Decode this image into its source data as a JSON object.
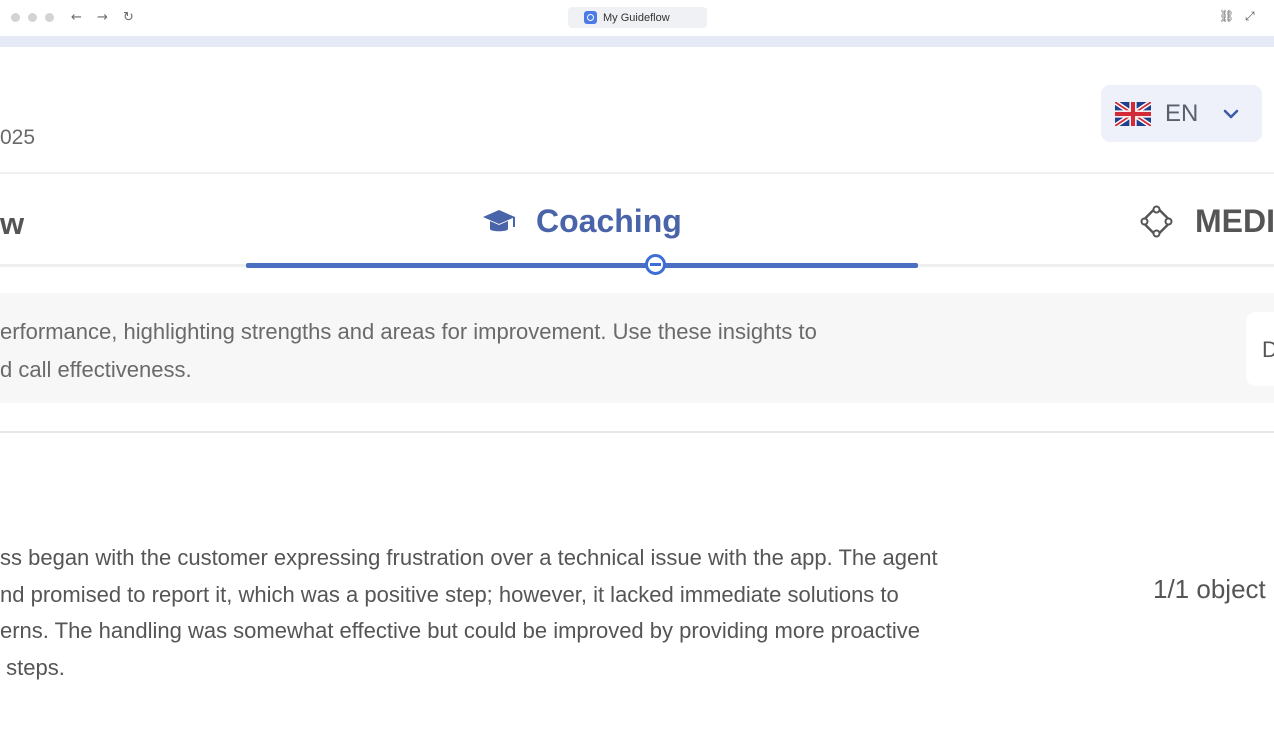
{
  "browser": {
    "tab_title": "My Guideflow",
    "back_icon": "arrow-left-icon",
    "forward_icon": "arrow-right-icon",
    "reload_icon": "reload-icon",
    "back_glyph": "←",
    "forward_glyph": "→",
    "reload_glyph": "↻",
    "link_glyph": "⛓",
    "expand_glyph": "⤢"
  },
  "header": {
    "date_fragment": "025",
    "language": {
      "code": "EN",
      "flag": "uk-flag-icon"
    }
  },
  "tabs": [
    {
      "label": "w",
      "icon": "",
      "active": false
    },
    {
      "label": "Coaching",
      "icon": "graduation-cap-icon",
      "active": true
    },
    {
      "label": "MEDI",
      "icon": "meddic-icon",
      "active": false
    }
  ],
  "description": {
    "line1": "erformance, highlighting strengths and areas for improvement. Use these insights to",
    "line2": "d call effectiveness.",
    "side_card_letter": "D"
  },
  "summary": {
    "lines": [
      "ss began with the customer expressing frustration over a technical issue with the app. The agent",
      "nd promised to report it, which was a positive step; however, it lacked immediate solutions to",
      "erns. The handling was somewhat effective but could be improved by providing more proactive",
      " steps."
    ],
    "objective_label": "1/1 object"
  },
  "colors": {
    "accent": "#4a64aa",
    "underline": "#4a6ec0",
    "lang_bg": "#eef1f9",
    "desc_bg": "#f7f7f8"
  }
}
